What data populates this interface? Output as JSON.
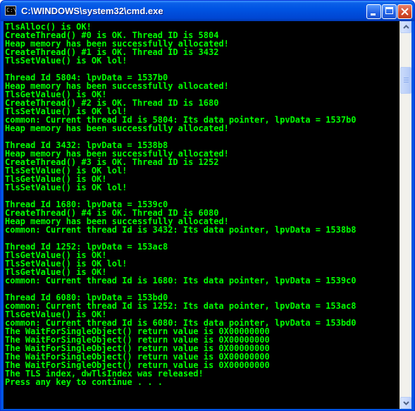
{
  "window": {
    "title": "C:\\WINDOWS\\system32\\cmd.exe",
    "icon_text": "C:\\",
    "icon": "console-icon"
  },
  "controls": {
    "minimize_icon": "minimize-icon",
    "maximize_icon": "maximize-icon",
    "close_icon": "close-icon"
  },
  "colors": {
    "console_background": "#000000",
    "console_text": "#00ff00",
    "titlebar": "#0054e3",
    "close_button": "#d54a2a"
  },
  "console": {
    "lines": [
      "TlsAlloc() is OK!",
      "CreateThread() #0 is OK. Thread ID is 5804",
      "Heap memory has been successfully allocated!",
      "CreateThread() #1 is OK. Thread ID is 3432",
      "TlsSetValue() is OK lol!",
      "",
      "Thread Id 5804: lpvData = 1537b0",
      "Heap memory has been successfully allocated!",
      "TlsGetValue() is OK!",
      "CreateThread() #2 is OK. Thread ID is 1680",
      "TlsSetValue() is OK lol!",
      "common: Current thread Id is 5804: Its data pointer, lpvData = 1537b0",
      "Heap memory has been successfully allocated!",
      "",
      "Thread Id 3432: lpvData = 1538b8",
      "Heap memory has been successfully allocated!",
      "CreateThread() #3 is OK. Thread ID is 1252",
      "TlsSetValue() is OK lol!",
      "TlsGetValue() is OK!",
      "TlsSetValue() is OK lol!",
      "",
      "Thread Id 1680: lpvData = 1539c0",
      "CreateThread() #4 is OK. Thread ID is 6080",
      "Heap memory has been successfully allocated!",
      "common: Current thread Id is 3432: Its data pointer, lpvData = 1538b8",
      "",
      "Thread Id 1252: lpvData = 153ac8",
      "TlsGetValue() is OK!",
      "TlsSetValue() is OK lol!",
      "TlsGetValue() is OK!",
      "common: Current thread Id is 1680: Its data pointer, lpvData = 1539c0",
      "",
      "Thread Id 6080: lpvData = 153bd0",
      "common: Current thread Id is 1252: Its data pointer, lpvData = 153ac8",
      "TlsGetValue() is OK!",
      "common: Current thread Id is 6080: Its data pointer, lpvData = 153bd0",
      "The WaitForSingleObject() return value is 0X00000000",
      "The WaitForSingleObject() return value is 0X00000000",
      "The WaitForSingleObject() return value is 0X00000000",
      "The WaitForSingleObject() return value is 0X00000000",
      "The WaitForSingleObject() return value is 0X00000000",
      "The TLS index, dwTlsIndex was released!",
      "Press any key to continue . . ."
    ]
  },
  "scrollbar": {
    "up_icon": "scroll-up-arrow-icon",
    "down_icon": "scroll-down-arrow-icon",
    "position_fraction": 0.1
  }
}
